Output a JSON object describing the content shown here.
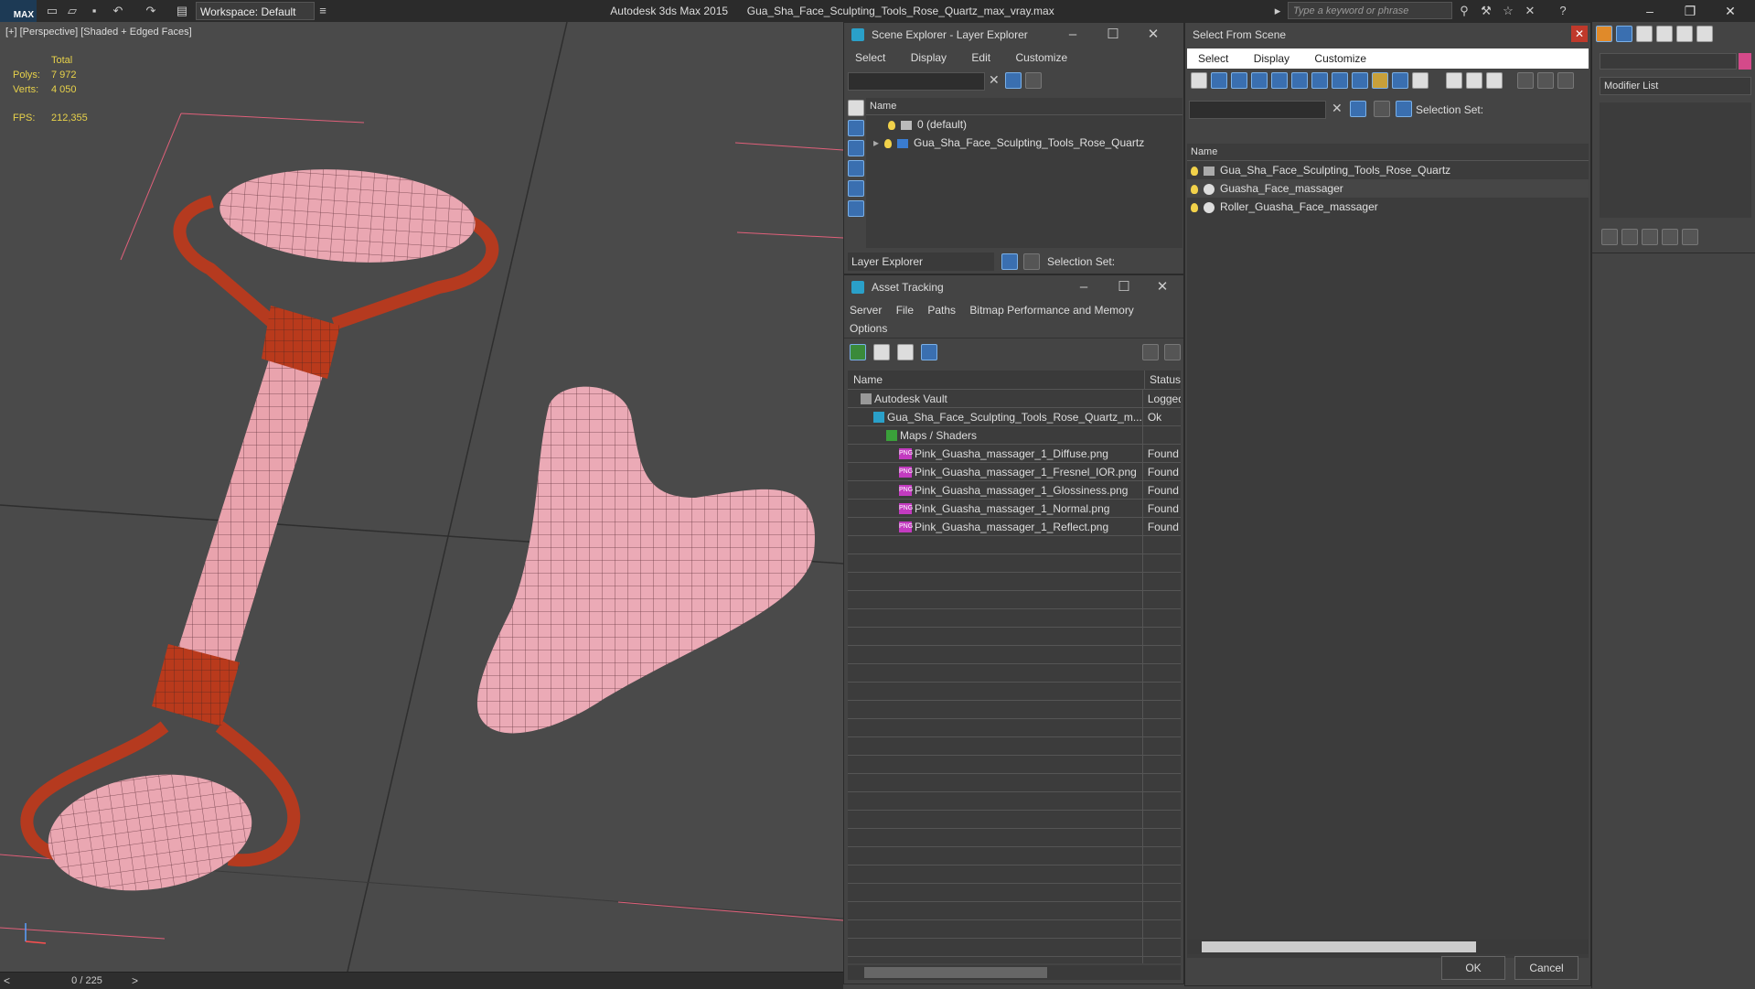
{
  "titlebar": {
    "logo": "MAX",
    "workspace": "Workspace: Default",
    "app": "Autodesk 3ds Max  2015",
    "file": "Gua_Sha_Face_Sculpting_Tools_Rose_Quartz_max_vray.max",
    "search_placeholder": "Type a keyword or phrase"
  },
  "viewport": {
    "label": "[+] [Perspective] [Shaded + Edged Faces]",
    "stats": {
      "total_label": "Total",
      "polys_label": "Polys:",
      "polys_value": "7 972",
      "verts_label": "Verts:",
      "verts_value": "4 050",
      "fps_label": "FPS:",
      "fps_value": "212,355"
    }
  },
  "timeline": {
    "frame": "0 / 225",
    "prev": "<",
    "next": ">"
  },
  "scene_explorer": {
    "title": "Scene Explorer - Layer Explorer",
    "menu": [
      "Select",
      "Display",
      "Edit",
      "Customize"
    ],
    "col_name": "Name",
    "rows": [
      "0 (default)",
      "Gua_Sha_Face_Sculpting_Tools_Rose_Quartz"
    ],
    "footer_dropdown": "Layer Explorer",
    "selection_set_label": "Selection Set:"
  },
  "asset_tracking": {
    "title": "Asset Tracking",
    "menu": [
      "Server",
      "File",
      "Paths",
      "Bitmap Performance and Memory"
    ],
    "menu2": "Options",
    "col_name": "Name",
    "col_status": "Status",
    "rows": [
      {
        "name": "Autodesk Vault",
        "status": "Logged",
        "indent": 1,
        "icon": "vault"
      },
      {
        "name": "Gua_Sha_Face_Sculpting_Tools_Rose_Quartz_m...",
        "status": "Ok",
        "indent": 2,
        "icon": "max"
      },
      {
        "name": "Maps / Shaders",
        "status": "",
        "indent": 3,
        "icon": "maps"
      },
      {
        "name": "Pink_Guasha_massager_1_Diffuse.png",
        "status": "Found",
        "indent": 4,
        "icon": "png"
      },
      {
        "name": "Pink_Guasha_massager_1_Fresnel_IOR.png",
        "status": "Found",
        "indent": 4,
        "icon": "png"
      },
      {
        "name": "Pink_Guasha_massager_1_Glossiness.png",
        "status": "Found",
        "indent": 4,
        "icon": "png"
      },
      {
        "name": "Pink_Guasha_massager_1_Normal.png",
        "status": "Found",
        "indent": 4,
        "icon": "png"
      },
      {
        "name": "Pink_Guasha_massager_1_Reflect.png",
        "status": "Found",
        "indent": 4,
        "icon": "png"
      }
    ],
    "png_icon_text": "PNG"
  },
  "select_from_scene": {
    "title": "Select From Scene",
    "menu": [
      "Select",
      "Display",
      "Customize"
    ],
    "selection_set_label": "Selection Set:",
    "col_name": "Name",
    "rows": [
      "Gua_Sha_Face_Sculpting_Tools_Rose_Quartz",
      "Guasha_Face_massager",
      "Roller_Guasha_Face_massager"
    ],
    "ok": "OK",
    "cancel": "Cancel"
  },
  "command_panel": {
    "modifier_list": "Modifier List"
  },
  "colors": {
    "accent": "#2aa0c9",
    "bulb": "#f2d24a",
    "stats_label": "#e8d24a",
    "close_red": "#c0392b",
    "png_icon": "#c33bc0"
  }
}
